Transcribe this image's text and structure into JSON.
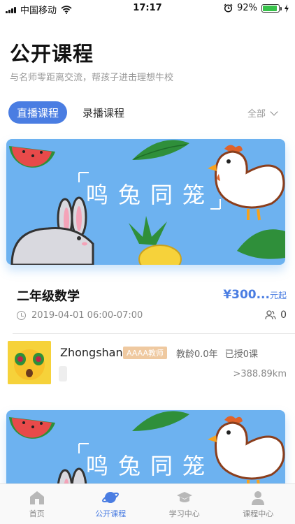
{
  "status_bar": {
    "carrier": "中国移动",
    "time": "17:17",
    "battery": "92%",
    "battery_level": 0.92,
    "icons": [
      "signal-icon",
      "wifi-icon",
      "alarm-icon",
      "battery-icon",
      "charging-icon"
    ]
  },
  "header": {
    "title": "公开课程",
    "subtitle": "与名师零距离交流，帮孩子进击理想牛校"
  },
  "tabs": {
    "live": "直播课程",
    "recorded": "录播课程",
    "filter": "全部"
  },
  "courses": [
    {
      "banner_title": "鸣兔同笼",
      "name": "二年级数学",
      "price": "¥300...",
      "price_suffix": "元起",
      "time": "2019-04-01 06:00-07:00",
      "attendees": "0",
      "teacher": {
        "name": "Zhongshan",
        "badge": "AAAA教师",
        "experience": "教龄0.0年",
        "taught": "已授0课",
        "distance": ">388.89km"
      }
    },
    {
      "banner_title": "鸣兔同笼"
    }
  ],
  "bottom_nav": [
    {
      "label": "首页",
      "icon": "home-icon"
    },
    {
      "label": "公开课程",
      "icon": "planet-icon"
    },
    {
      "label": "学习中心",
      "icon": "graduation-cap-icon"
    },
    {
      "label": "课程中心",
      "icon": "person-icon"
    }
  ],
  "colors": {
    "accent": "#4a7de2",
    "banner_bg": "#6db2f0",
    "badge": "#efc9a0"
  }
}
